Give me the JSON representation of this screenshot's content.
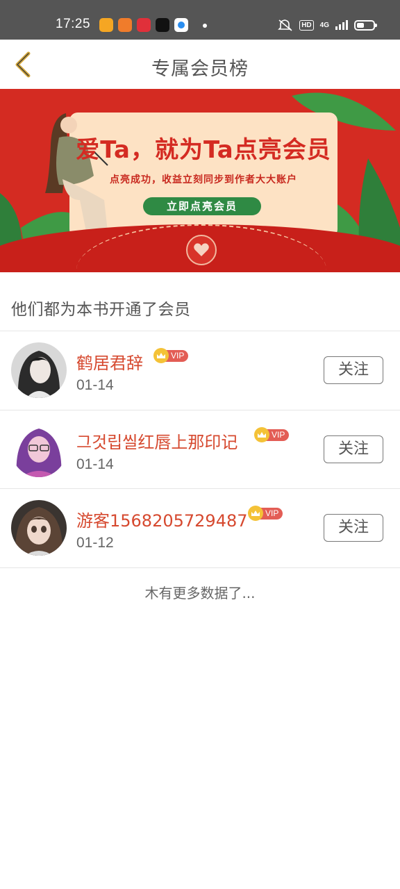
{
  "status_bar": {
    "time": "17:25",
    "network": "4G",
    "hd": "HD",
    "icons": [
      "weibo-icon",
      "sogou-icon",
      "heart-app-icon",
      "tiktok-icon",
      "circle-app-icon",
      "mute-icon",
      "hd-icon",
      "signal-icon",
      "battery-icon"
    ]
  },
  "header": {
    "title": "专属会员榜",
    "back_icon": "chevron-left-icon",
    "accent_color": "#d4a73a"
  },
  "banner": {
    "headline": "爱Ta，就为Ta点亮会员",
    "subline": "点亮成功，收益立刻同步到作者大大账户",
    "cta": "立即点亮会员",
    "background_color": "#d42b22"
  },
  "section": {
    "title": "他们都为本书开通了会员"
  },
  "members": [
    {
      "name": "鹤居君辞",
      "badge": "VIP",
      "date": "01-14",
      "follow_label": "关注"
    },
    {
      "name": "그것립씰红唇上那印记",
      "badge": "VIP",
      "date": "01-14",
      "follow_label": "关注"
    },
    {
      "name": "游客1568205729487",
      "badge": "VIP",
      "date": "01-12",
      "follow_label": "关注"
    }
  ],
  "footer": {
    "no_more": "木有更多数据了..."
  },
  "colors": {
    "name_color": "#d6492f",
    "vip_color": "#e35d55",
    "crown_color": "#f4c237"
  }
}
